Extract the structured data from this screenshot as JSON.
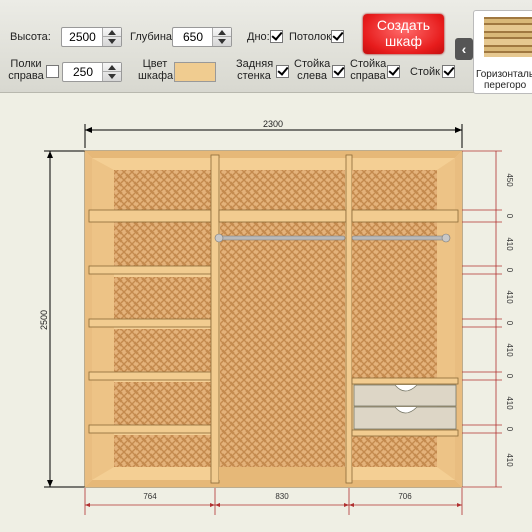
{
  "toolbar": {
    "height_label": "Высота:",
    "height_value": "2500",
    "depth_label": "Глубина:",
    "depth_value": "650",
    "bottom_label": "Дно:",
    "bottom_checked": true,
    "ceiling_label": "Потолок:",
    "ceiling_checked": true,
    "shelves_right_label_1": "Полки",
    "shelves_right_label_2": "справа",
    "shelves_right_checked": false,
    "shelves_right_value": "250",
    "color_label_1": "Цвет",
    "color_label_2": "шкафа",
    "color_value": "#f0cc90",
    "back_wall_label_1": "Задняя",
    "back_wall_label_2": "стенка",
    "back_wall_checked": true,
    "post_left_label_1": "Стойка",
    "post_left_label_2": "слева",
    "post_left_checked": true,
    "post_right_label_1": "Стойка",
    "post_right_label_2": "справа",
    "post_right_checked": true,
    "post_label": "Стойк",
    "post_checked": true,
    "create_button_1": "Создать",
    "create_button_2": "шкаф",
    "collapse_icon": "‹"
  },
  "side_panel": {
    "item_label_1": "Горизонталь",
    "item_label_2": "перегоро"
  },
  "drawing": {
    "total_width": "2300",
    "total_height": "2500",
    "section_widths": [
      "764",
      "830",
      "706"
    ],
    "right_dims": [
      "450",
      "0",
      "410",
      "0",
      "410",
      "0",
      "410",
      "0",
      "410",
      "0",
      "410"
    ],
    "wood_color": "#f2cb8e",
    "frame_color": "#d9a658",
    "dim_color_red": "#b03030"
  }
}
